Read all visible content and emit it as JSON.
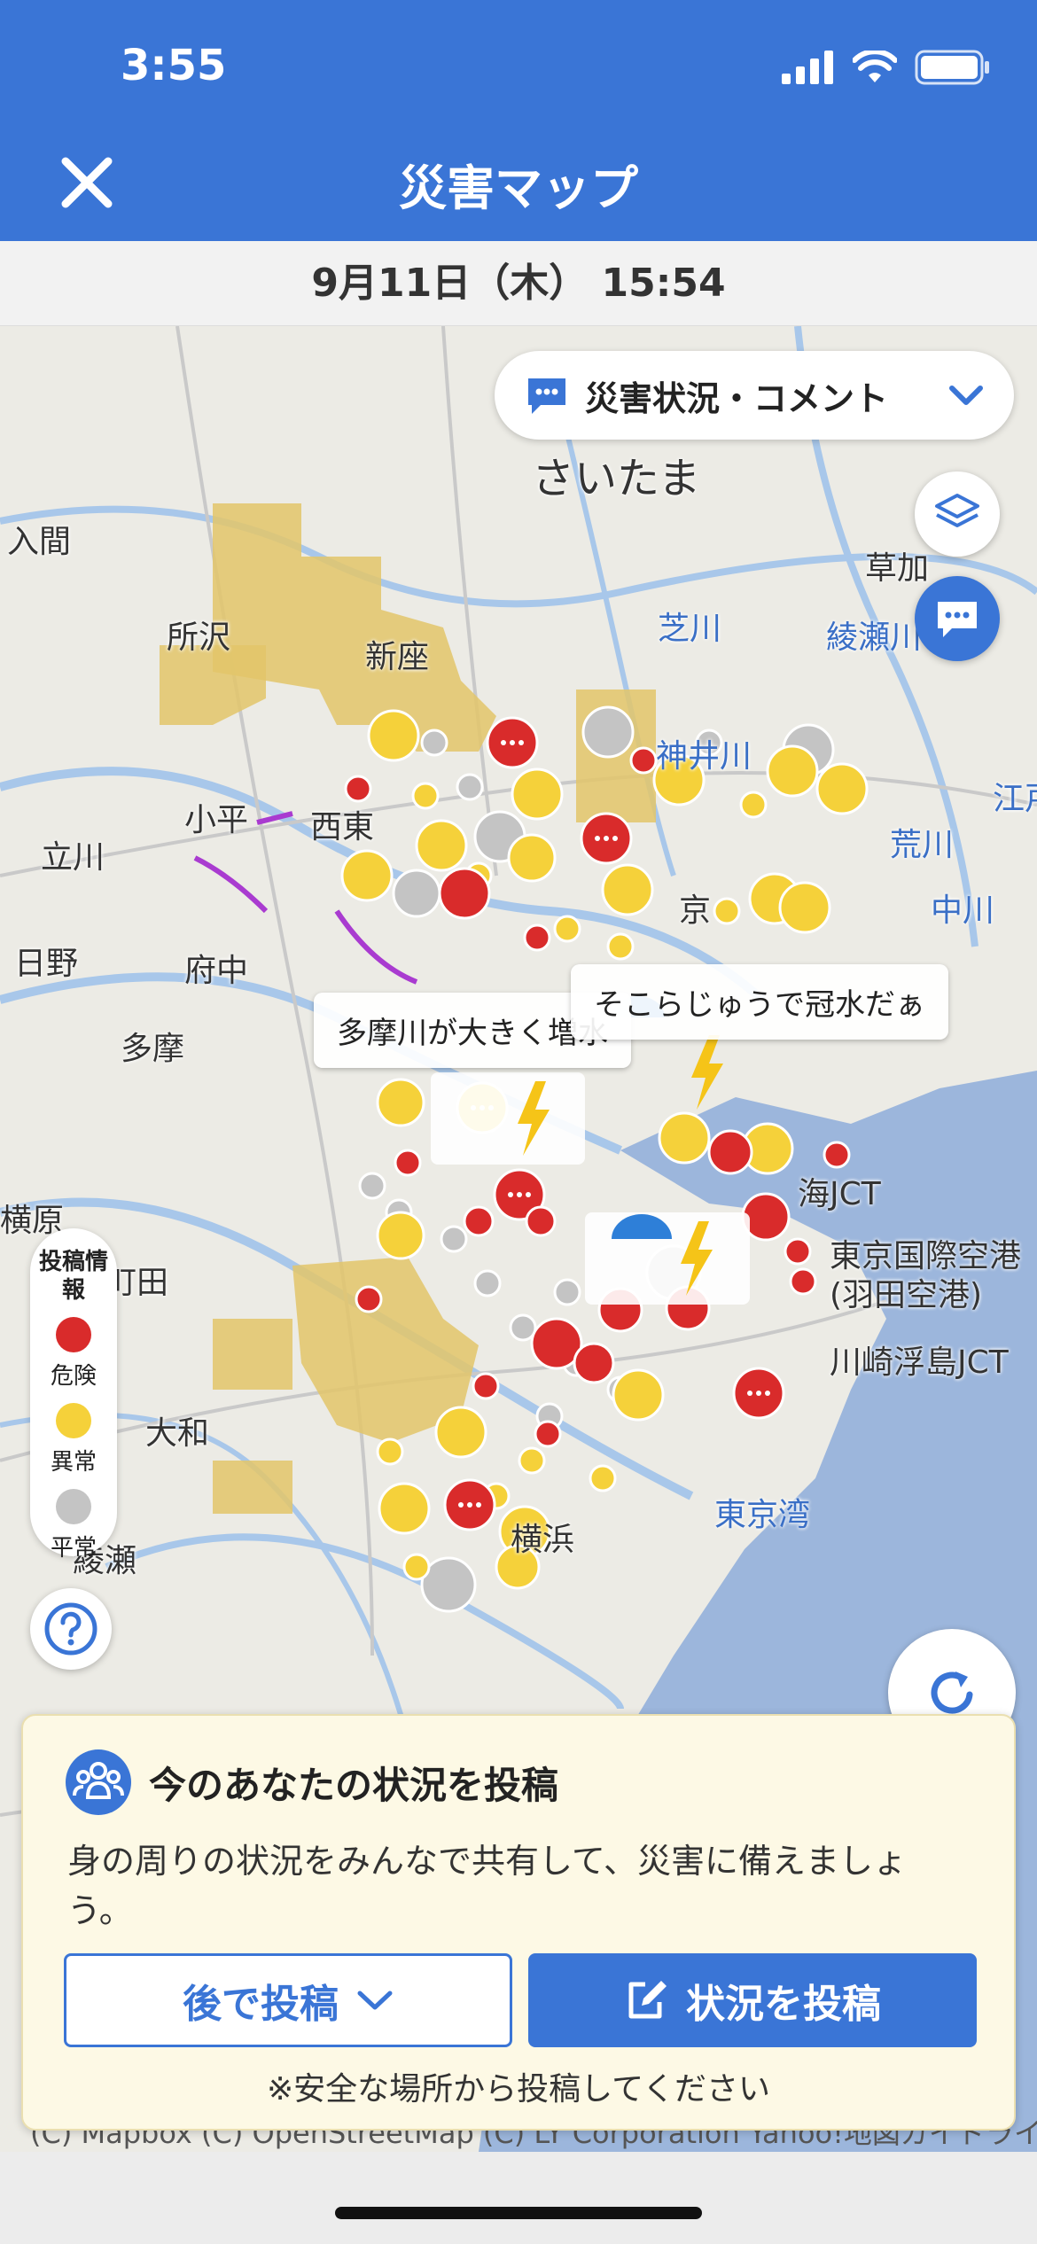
{
  "status_bar": {
    "time": "3:55"
  },
  "header": {
    "title": "災害マップ",
    "close_icon": "close-icon"
  },
  "date_bar": {
    "datetime": "9月11日（木） 15:54"
  },
  "map": {
    "category_select": {
      "label": "災害状況・コメント",
      "icon": "comment-icon"
    },
    "place_labels": [
      {
        "name": "さいたま",
        "big": true
      },
      {
        "name": "入間"
      },
      {
        "name": "所沢"
      },
      {
        "name": "新座"
      },
      {
        "name": "草加"
      },
      {
        "name": "綾瀬川",
        "blue": true
      },
      {
        "name": "芝川",
        "blue": true
      },
      {
        "name": "小平"
      },
      {
        "name": "西東"
      },
      {
        "name": "立川"
      },
      {
        "name": "荒川",
        "blue": true
      },
      {
        "name": "中川",
        "blue": true
      },
      {
        "name": "日野"
      },
      {
        "name": "府中"
      },
      {
        "name": "多摩"
      },
      {
        "name": "横原"
      },
      {
        "name": "町田"
      },
      {
        "name": "大和"
      },
      {
        "name": "綾瀬"
      },
      {
        "name": "東京国際空港"
      },
      {
        "name": "(羽田空港)"
      },
      {
        "name": "川崎浮島JCT"
      },
      {
        "name": "東京湾",
        "blue": true
      },
      {
        "name": "横浜"
      },
      {
        "name": "海JCT"
      },
      {
        "name": "京"
      },
      {
        "name": "江戸",
        "blue": true
      },
      {
        "name": "神井川",
        "blue": true
      }
    ],
    "comment_bubbles": [
      {
        "text": "多摩川が大きく増水"
      },
      {
        "text": "そこらじゅうで冠水だぁ"
      }
    ],
    "legend": {
      "heading": "投稿情報",
      "items": [
        {
          "label": "危険",
          "color": "#d92b2b"
        },
        {
          "label": "異常",
          "color": "#f5d13a"
        },
        {
          "label": "平常",
          "color": "#c4c4c4"
        }
      ]
    },
    "buttons": {
      "layers_icon": "layers-icon",
      "comment_icon": "chat-icon",
      "help_icon": "help-icon",
      "refresh_icon": "refresh-icon"
    },
    "copyright": "(C) Mapbox (C) OpenStreetMap (C) LY Corporation Yahoo!地図ガイドライン"
  },
  "post_card": {
    "title": "今のあなたの状況を投稿",
    "description": "身の周りの状況をみんなで共有して、災害に備えましょう。",
    "later_button": "後で投稿",
    "post_button": "状況を投稿",
    "note": "※安全な場所から投稿してください"
  },
  "colors": {
    "brand": "#3a75d6",
    "danger": "#d92b2b",
    "warning": "#f5d13a",
    "normal": "#c4c4c4"
  }
}
